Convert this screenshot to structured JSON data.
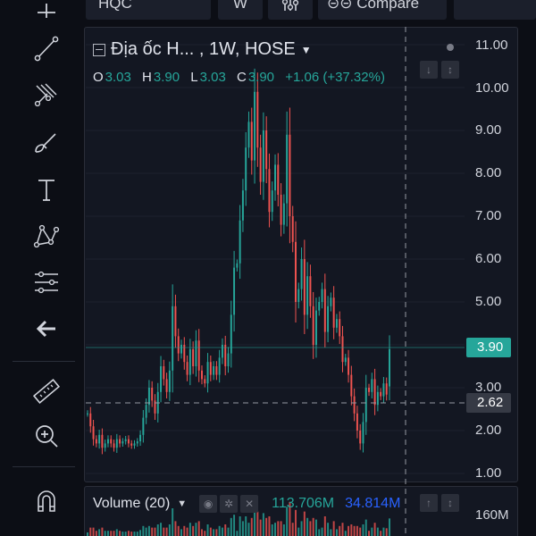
{
  "toolbar": {
    "symbol": "HQC",
    "interval": "W",
    "indicators_icon": "indicators-icon",
    "compare_label": "Compare"
  },
  "left_tools": [
    {
      "icon": "crosshair-icon"
    },
    {
      "icon": "trend-line-icon"
    },
    {
      "icon": "fib-icon"
    },
    {
      "icon": "brush-icon"
    },
    {
      "icon": "text-icon"
    },
    {
      "icon": "pattern-icon"
    },
    {
      "icon": "projection-icon"
    },
    {
      "icon": "back-arrow-icon"
    },
    {
      "icon": "ruler-icon"
    },
    {
      "icon": "zoom-in-icon"
    },
    {
      "icon": "magnet-icon"
    }
  ],
  "legend": {
    "title": "Địa ốc H... , 1W, HOSE",
    "o_label": "O",
    "o": "3.03",
    "h_label": "H",
    "h": "3.90",
    "l_label": "L",
    "l": "3.03",
    "c_label": "C",
    "c": "3.90",
    "change": "+1.06 (+37.32%)"
  },
  "price_axis": {
    "ticks": [
      "11.00",
      "10.00",
      "9.00",
      "8.00",
      "7.00",
      "6.00",
      "5.00",
      "3.00",
      "2.00",
      "1.00"
    ],
    "last_price": "3.90",
    "crosshair_price": "2.62"
  },
  "volume": {
    "label": "Volume (20)",
    "value1": "113.706M",
    "value2": "34.814M",
    "axis_tick": "160M"
  },
  "colors": {
    "up": "#26a69a",
    "down": "#ef5350",
    "background": "#131722"
  },
  "chart_data": {
    "type": "candlestick",
    "title": "Địa ốc H... , 1W, HOSE",
    "ylim": [
      1,
      11
    ],
    "close": [
      2.4,
      2.1,
      1.8,
      1.7,
      1.9,
      1.6,
      1.7,
      1.8,
      1.7,
      1.6,
      1.8,
      1.7,
      1.75,
      1.8,
      1.7,
      1.65,
      1.7,
      1.75,
      1.9,
      2.3,
      2.6,
      3.0,
      2.7,
      2.4,
      2.9,
      3.5,
      3.2,
      2.9,
      3.4,
      4.9,
      4.2,
      3.8,
      4.0,
      3.6,
      3.3,
      3.9,
      3.5,
      4.1,
      3.4,
      3.2,
      3.1,
      3.6,
      3.3,
      3.5,
      3.3,
      3.7,
      4.0,
      3.5,
      3.8,
      4.7,
      5.8,
      5.9,
      6.9,
      7.6,
      8.6,
      9.2,
      8.3,
      9.9,
      8.6,
      7.8,
      9.0,
      8.1,
      7.1,
      7.6,
      8.2,
      7.5,
      6.8,
      7.3,
      8.9,
      7.0,
      6.4,
      5.0,
      5.3,
      6.0,
      4.7,
      5.6,
      4.9,
      4.0,
      4.8,
      5.0,
      5.3,
      4.3,
      4.9,
      5.1,
      4.4,
      4.6,
      4.2,
      3.6,
      3.7,
      3.3,
      2.8,
      2.4,
      2.0,
      1.7,
      2.2,
      3.0,
      2.9,
      3.2,
      2.6,
      2.9,
      2.8,
      3.1,
      2.84,
      3.9
    ],
    "ohlc_last": {
      "open": 3.03,
      "high": 3.9,
      "low": 3.03,
      "close": 3.9
    }
  }
}
